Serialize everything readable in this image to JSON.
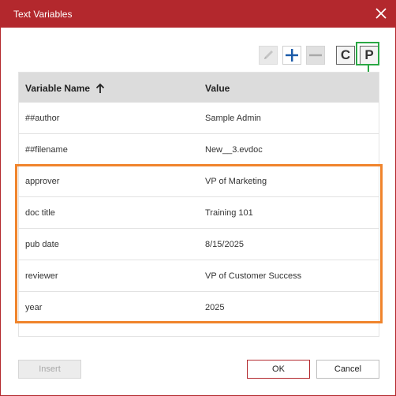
{
  "dialog": {
    "title": "Text Variables",
    "accent_color": "#b3282d"
  },
  "toolbar": {
    "edit_icon": "pencil-icon",
    "add_icon": "plus-icon",
    "remove_icon": "minus-icon",
    "c_label": "C",
    "p_label": "P"
  },
  "table": {
    "columns": [
      "Variable Name",
      "Value"
    ],
    "sort_icon": "arrow-up-icon",
    "rows": [
      {
        "name": "##author",
        "value": "Sample Admin"
      },
      {
        "name": "##filename",
        "value": "New__3.evdoc"
      },
      {
        "name": "approver",
        "value": "VP of Marketing"
      },
      {
        "name": "doc title",
        "value": "Training 101"
      },
      {
        "name": "pub date",
        "value": "8/15/2025"
      },
      {
        "name": "reviewer",
        "value": "VP of Customer Success"
      },
      {
        "name": "year",
        "value": "2025"
      }
    ]
  },
  "annotations": {
    "green_color": "#2aa744",
    "orange_color": "#f0842c"
  },
  "footer": {
    "insert_label": "Insert",
    "ok_label": "OK",
    "cancel_label": "Cancel"
  }
}
